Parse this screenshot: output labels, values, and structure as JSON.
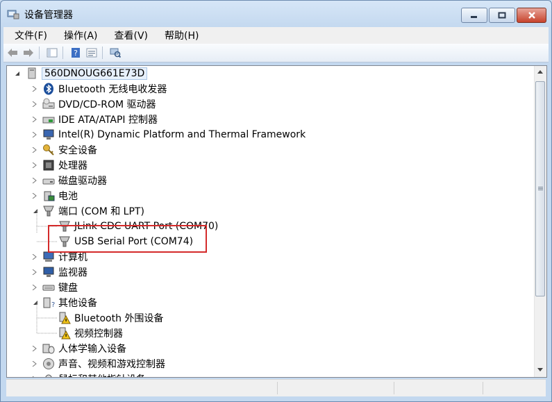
{
  "window": {
    "title": "设备管理器"
  },
  "menu": [
    "文件(F)",
    "操作(A)",
    "查看(V)",
    "帮助(H)"
  ],
  "tree": {
    "root": "560DNOUG661E73D",
    "items": [
      {
        "label": "Bluetooth 无线电收发器",
        "icon": "bluetooth-icon"
      },
      {
        "label": "DVD/CD-ROM 驱动器",
        "icon": "dvd-drive-icon"
      },
      {
        "label": "IDE ATA/ATAPI 控制器",
        "icon": "ide-controller-icon"
      },
      {
        "label": "Intel(R) Dynamic Platform and Thermal Framework",
        "icon": "monitor-device-icon"
      },
      {
        "label": "安全设备",
        "icon": "key-icon"
      },
      {
        "label": "处理器",
        "icon": "processor-icon"
      },
      {
        "label": "磁盘驱动器",
        "icon": "disk-drive-icon"
      },
      {
        "label": "电池",
        "icon": "battery-icon"
      },
      {
        "label": "端口 (COM 和 LPT)",
        "icon": "port-icon"
      },
      {
        "label": "JLink CDC UART Port (COM70)",
        "icon": "port-icon"
      },
      {
        "label": "USB Serial Port (COM74)",
        "icon": "port-icon"
      },
      {
        "label": "计算机",
        "icon": "computer-icon"
      },
      {
        "label": "监视器",
        "icon": "monitor-icon"
      },
      {
        "label": "键盘",
        "icon": "keyboard-icon"
      },
      {
        "label": "其他设备",
        "icon": "other-devices-icon"
      },
      {
        "label": "Bluetooth 外围设备",
        "icon": "warning-device-icon"
      },
      {
        "label": "视频控制器",
        "icon": "warning-device-icon"
      },
      {
        "label": "人体学输入设备",
        "icon": "hid-icon"
      },
      {
        "label": "声音、视频和游戏控制器",
        "icon": "sound-icon"
      },
      {
        "label": "鼠标和其他指针设备",
        "icon": "mouse-icon"
      }
    ]
  },
  "highlight_color": "#d42a2a"
}
